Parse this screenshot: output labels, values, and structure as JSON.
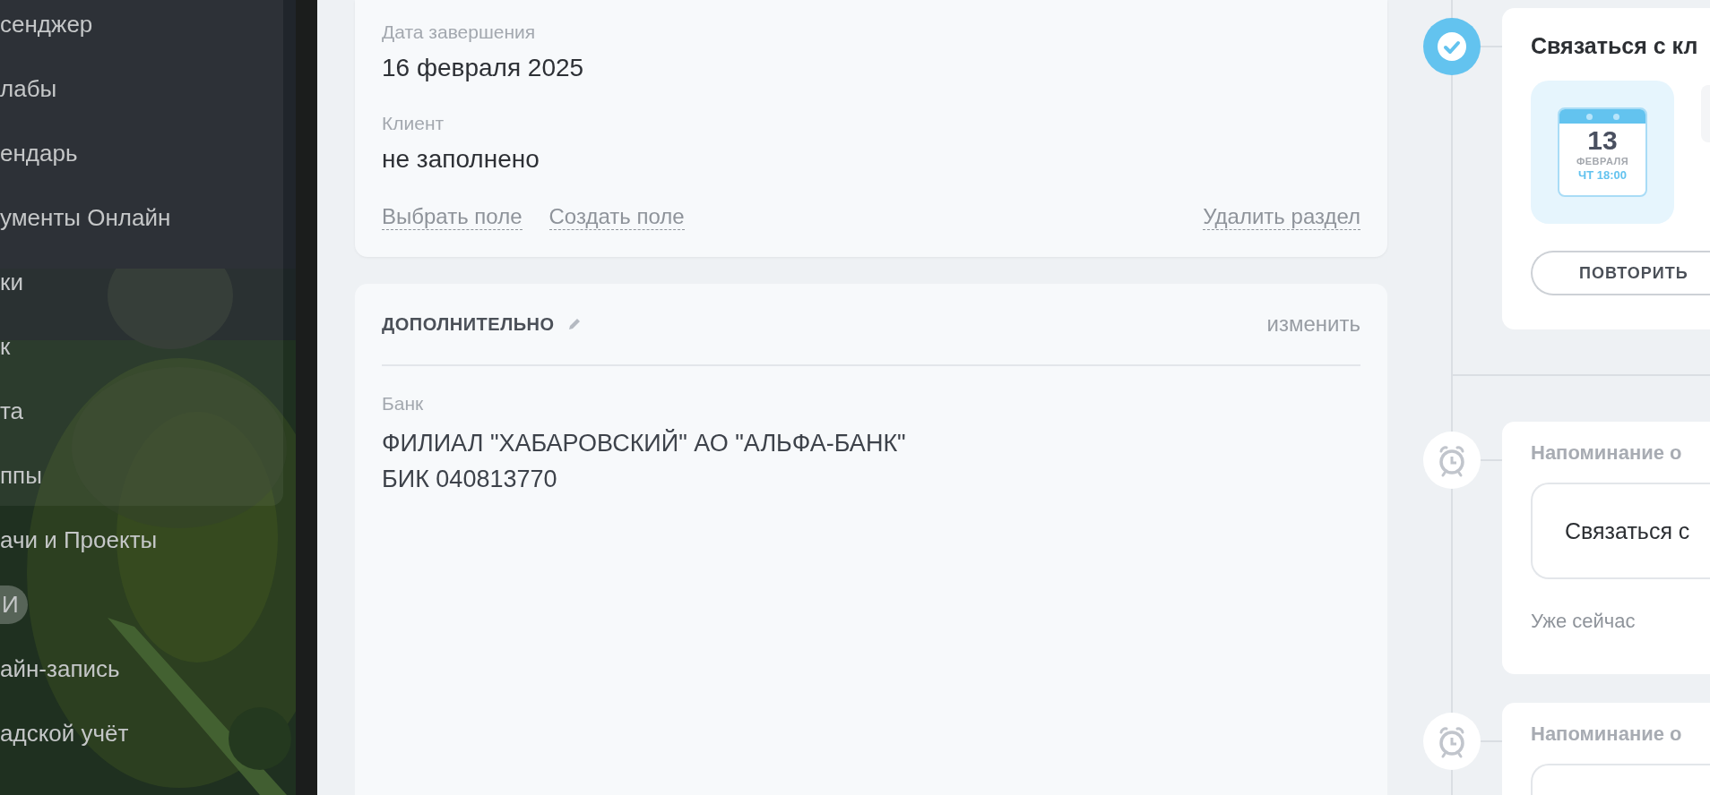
{
  "sidebar": {
    "items": [
      {
        "label": "сенджер",
        "kind": "item"
      },
      {
        "label": "лабы",
        "kind": "item"
      },
      {
        "label": "ендарь",
        "kind": "item"
      },
      {
        "label": "ументы Онлайн",
        "kind": "item"
      },
      {
        "label": "ки",
        "kind": "item"
      },
      {
        "label": "к",
        "kind": "item"
      },
      {
        "label": "та",
        "kind": "item"
      },
      {
        "label": "ппы",
        "kind": "item"
      },
      {
        "label": "ачи и Проекты",
        "kind": "item"
      },
      {
        "label": "И",
        "kind": "badge"
      },
      {
        "label": "айн-запись",
        "kind": "item"
      },
      {
        "label": "адской учёт",
        "kind": "item"
      }
    ]
  },
  "details_card": {
    "fields": [
      {
        "label": "Дата завершения",
        "value": "16 февраля 2025"
      },
      {
        "label": "Клиент",
        "value": "не заполнено"
      }
    ],
    "links": [
      "Выбрать поле",
      "Создать поле"
    ],
    "delete_link": "Удалить раздел"
  },
  "extra_card": {
    "title": "ДОПОЛНИТЕЛЬНО",
    "edit_link": "изменить",
    "fields": [
      {
        "label": "Банк",
        "value": "ФИЛИАЛ \"ХАБАРОВСКИЙ\" АО \"АЛЬФА-БАНК\"\nБИК 040813770"
      }
    ]
  },
  "timeline": [
    {
      "kind": "task",
      "done": true,
      "title": "Связаться с кл",
      "date": {
        "day": "13",
        "month": "ФЕВРАЛЯ",
        "time": "ЧТ 18:00"
      },
      "button": "ПОВТОРИТЬ"
    },
    {
      "kind": "reminder",
      "done": false,
      "title": "Напоминание о",
      "text": "Связаться с",
      "note": "Уже сейчас"
    },
    {
      "kind": "reminder",
      "done": false,
      "title": "Напоминание о"
    }
  ]
}
